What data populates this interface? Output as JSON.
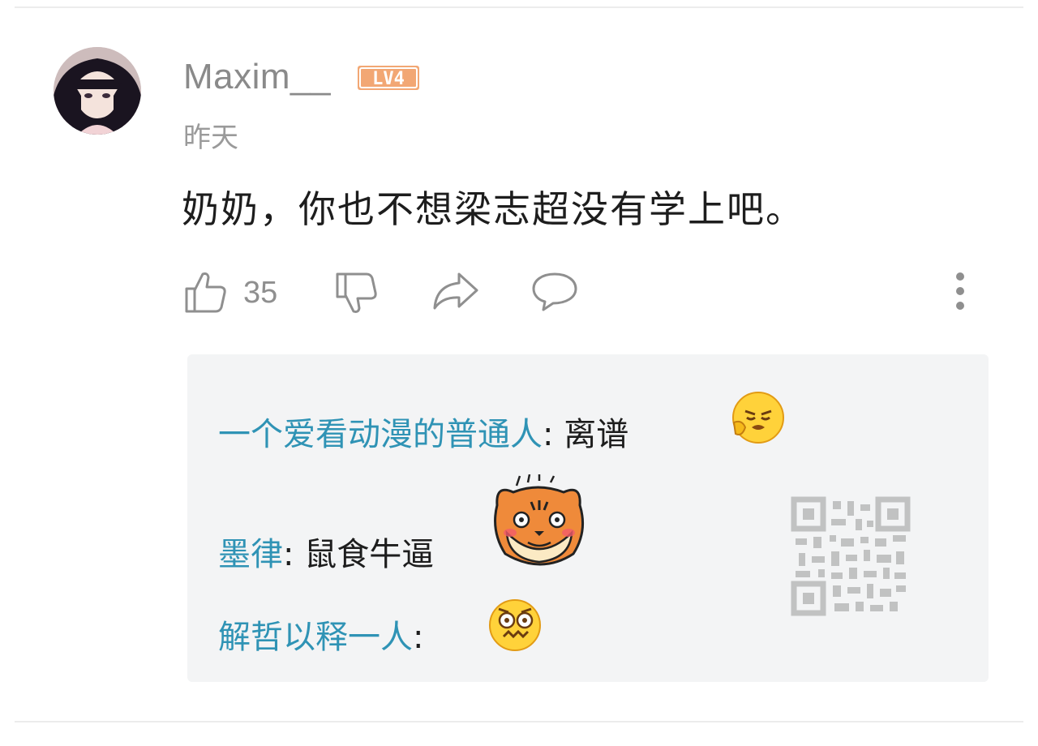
{
  "comment": {
    "username": "Maxim__",
    "level_badge": "LV4",
    "time": "昨天",
    "text": "奶奶，你也不想梁志超没有学上吧。",
    "like_count": "35"
  },
  "icons": {
    "like": "thumbs-up-icon",
    "dislike": "thumbs-down-icon",
    "share": "share-icon",
    "reply": "comment-icon",
    "more": "more-vertical-icon"
  },
  "replies": [
    {
      "name": "一个爱看动漫的普通人",
      "colon": ": ",
      "text": "离谱",
      "emoji": "frustrated-emoji"
    },
    {
      "name": "墨律",
      "colon": ": ",
      "text": "鼠食牛逼",
      "emoji": "tiger-sticker"
    },
    {
      "name": "解哲以释一人",
      "colon": ": ",
      "text": "",
      "emoji": "shocked-emoji"
    }
  ],
  "colors": {
    "reply_name": "#2f93b5",
    "level_badge": "#f2a774",
    "meta_gray": "#9a9a9a",
    "reply_bg": "#f3f4f5"
  }
}
